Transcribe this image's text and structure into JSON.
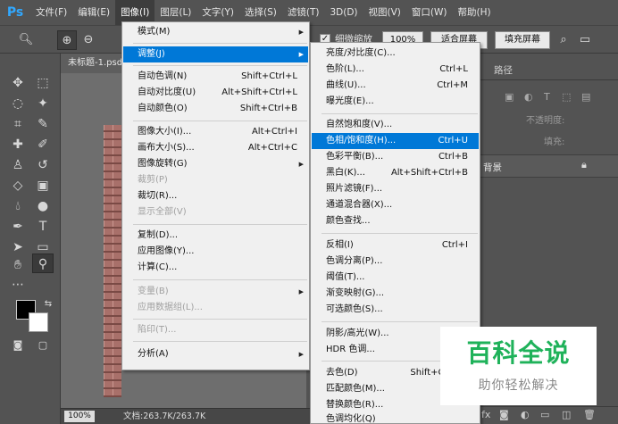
{
  "app": {
    "logo": "Ps"
  },
  "menubar": {
    "items": [
      "文件(F)",
      "编辑(E)",
      "图像(I)",
      "图层(L)",
      "文字(Y)",
      "选择(S)",
      "滤镜(T)",
      "3D(D)",
      "视图(V)",
      "窗口(W)",
      "帮助(H)"
    ],
    "active_index": 2
  },
  "options": {
    "fine_zoom_check": "✓",
    "fine_zoom_label": "细微缩放",
    "zoom_value": "100%",
    "fit_screen": "适合屏幕",
    "fill_screen": "填充屏幕"
  },
  "document": {
    "tab_title": "未标题-1.psd",
    "zoom": "100%",
    "info": "文档:263.7K/263.7K"
  },
  "panels": {
    "paths_tab": "路径",
    "opacity_label": "不透明度:",
    "fill_label": "填充:",
    "layer_name": "背景"
  },
  "image_menu": {
    "items": [
      {
        "label": "模式(M)",
        "submenu": true
      },
      {
        "label": "调整(J)",
        "submenu": true,
        "highlighted": true
      },
      {
        "label": "自动色调(N)",
        "shortcut": "Shift+Ctrl+L"
      },
      {
        "label": "自动对比度(U)",
        "shortcut": "Alt+Shift+Ctrl+L"
      },
      {
        "label": "自动颜色(O)",
        "shortcut": "Shift+Ctrl+B"
      },
      {
        "label": "图像大小(I)...",
        "shortcut": "Alt+Ctrl+I"
      },
      {
        "label": "画布大小(S)...",
        "shortcut": "Alt+Ctrl+C"
      },
      {
        "label": "图像旋转(G)",
        "submenu": true
      },
      {
        "label": "裁剪(P)",
        "disabled": true
      },
      {
        "label": "裁切(R)..."
      },
      {
        "label": "显示全部(V)",
        "disabled": true
      },
      {
        "label": "复制(D)..."
      },
      {
        "label": "应用图像(Y)..."
      },
      {
        "label": "计算(C)..."
      },
      {
        "label": "变量(B)",
        "submenu": true,
        "disabled": true
      },
      {
        "label": "应用数据组(L)...",
        "disabled": true
      },
      {
        "label": "陷印(T)...",
        "disabled": true
      },
      {
        "label": "分析(A)",
        "submenu": true
      }
    ]
  },
  "adjust_menu": {
    "items": [
      {
        "label": "亮度/对比度(C)..."
      },
      {
        "label": "色阶(L)...",
        "shortcut": "Ctrl+L"
      },
      {
        "label": "曲线(U)...",
        "shortcut": "Ctrl+M"
      },
      {
        "label": "曝光度(E)..."
      },
      {
        "label": "自然饱和度(V)..."
      },
      {
        "label": "色相/饱和度(H)...",
        "shortcut": "Ctrl+U",
        "highlighted": true
      },
      {
        "label": "色彩平衡(B)...",
        "shortcut": "Ctrl+B"
      },
      {
        "label": "黑白(K)...",
        "shortcut": "Alt+Shift+Ctrl+B"
      },
      {
        "label": "照片滤镜(F)..."
      },
      {
        "label": "通道混合器(X)..."
      },
      {
        "label": "颜色查找..."
      },
      {
        "label": "反相(I)",
        "shortcut": "Ctrl+I"
      },
      {
        "label": "色调分离(P)..."
      },
      {
        "label": "阈值(T)..."
      },
      {
        "label": "渐变映射(G)..."
      },
      {
        "label": "可选颜色(S)..."
      },
      {
        "label": "阴影/高光(W)..."
      },
      {
        "label": "HDR 色调..."
      },
      {
        "label": "去色(D)",
        "shortcut": "Shift+Ctrl+U"
      },
      {
        "label": "匹配颜色(M)..."
      },
      {
        "label": "替换颜色(R)..."
      },
      {
        "label": "色调均化(Q)"
      }
    ]
  },
  "watermark": {
    "title": "百科全说",
    "subtitle": "助你轻松解决"
  }
}
